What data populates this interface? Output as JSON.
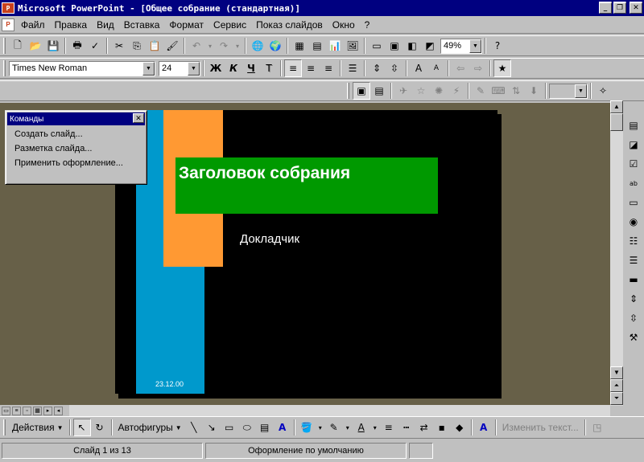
{
  "window": {
    "title": "Microsoft PowerPoint - [Общее собрание (стандартная)]",
    "app_icon": "powerpoint-icon",
    "controls": [
      "minimize",
      "restore",
      "close"
    ]
  },
  "menu": {
    "items": [
      "Файл",
      "Правка",
      "Вид",
      "Вставка",
      "Формат",
      "Сервис",
      "Показ слайдов",
      "Окно",
      "?"
    ]
  },
  "standard_toolbar": {
    "zoom": "49%",
    "icons": [
      "new-icon",
      "open-icon",
      "save-icon",
      "print-icon",
      "spelling-icon",
      "cut-icon",
      "copy-icon",
      "paste-icon",
      "format-painter-icon",
      "undo-icon",
      "redo-icon",
      "hyperlink-icon",
      "web-toolbar-icon",
      "insert-table-icon",
      "insert-chart-icon",
      "insert-chart-icon",
      "insert-clipart-icon",
      "new-slide-icon",
      "slide-layout-icon",
      "apply-design-icon",
      "grayscale-icon",
      "help-icon"
    ]
  },
  "format_toolbar": {
    "font_name": "Times New Roman",
    "font_size": "24",
    "bold": "Ж",
    "italic": "К",
    "underline": "Ч",
    "shadow": "Т"
  },
  "commands_panel": {
    "title": "Команды",
    "items": [
      "Создать слайд...",
      "Разметка слайда...",
      "Применить оформление..."
    ]
  },
  "slide": {
    "title": "Заголовок собрания",
    "subtitle": "Докладчик",
    "date": "23.12.00",
    "colors": {
      "background": "#000000",
      "cyan": "#0099cc",
      "orange": "#ff9933",
      "green": "#009900"
    }
  },
  "drawing_toolbar": {
    "actions_label": "Действия",
    "autoshapes_label": "Автофигуры",
    "edit_text_label": "Изменить текст..."
  },
  "statusbar": {
    "slide_info": "Слайд 1 из 13",
    "design": "Оформление по умолчанию"
  }
}
